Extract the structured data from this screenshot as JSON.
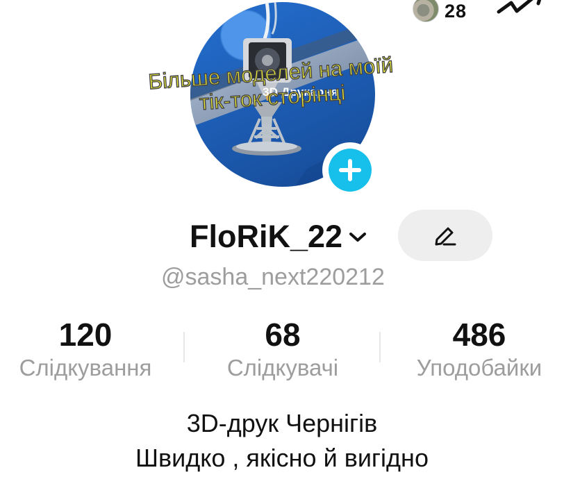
{
  "notifications": {
    "count": "28",
    "avatar_icon": "friend-avatar",
    "activity_icon": "trend-arrow-icon"
  },
  "profile": {
    "avatar": {
      "brand_text": "3D Друкарня",
      "overlay_lines": [
        "Більше моделей на моїй",
        "тік-ток сторінці"
      ],
      "overlay_color": "#f0ef37",
      "add_button_icon": "plus-icon",
      "add_button_color": "#16c0eb"
    },
    "username": "FloRiK_22",
    "username_icon": "chevron-down-icon",
    "handle": "@sasha_next220212",
    "edit_button_icon": "pencil-icon"
  },
  "stats": [
    {
      "value": "120",
      "label": "Слідкування"
    },
    {
      "value": "68",
      "label": "Слідкувачі"
    },
    {
      "value": "486",
      "label": "Уподобайки"
    }
  ],
  "bio": {
    "lines": [
      "3D-друк Чернігів",
      "Швидко , якісно й вигідно"
    ]
  }
}
